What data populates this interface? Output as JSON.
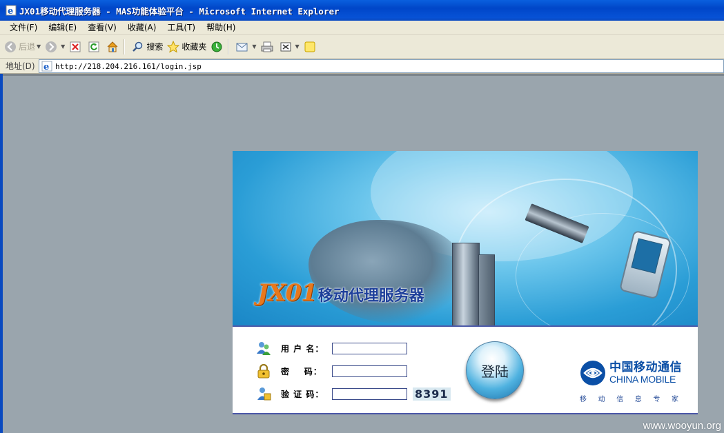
{
  "window": {
    "title": "JX01移动代理服务器 - MAS功能体验平台 - Microsoft Internet Explorer"
  },
  "menu": [
    "文件(F)",
    "编辑(E)",
    "查看(V)",
    "收藏(A)",
    "工具(T)",
    "帮助(H)"
  ],
  "toolbar": {
    "back_label": "后退",
    "search_label": "搜索",
    "favorites_label": "收藏夹"
  },
  "address": {
    "label": "地址(D)",
    "url": "http://218.204.216.161/login.jsp"
  },
  "banner": {
    "logo_text": "JX01",
    "product_name": "移动代理服务器"
  },
  "form": {
    "username_label": "用 户 名：",
    "password_label": "密    码：",
    "captcha_label": "验 证 码：",
    "username_value": "",
    "password_value": "",
    "captcha_value": "",
    "captcha_code": "8391",
    "login_button": "登陆"
  },
  "brand": {
    "name_cn": "中国移动通信",
    "name_en": "CHINA MOBILE",
    "slogan": [
      "移",
      "动",
      "信",
      "息",
      "专",
      "家"
    ]
  },
  "watermark": "www.wooyun.org",
  "colors": {
    "titlebar": "#0046c8",
    "chrome": "#ece9d8",
    "page_bg": "#9aa5ad",
    "brand_blue": "#0b4fa6",
    "logo_orange": "#e8781c"
  }
}
